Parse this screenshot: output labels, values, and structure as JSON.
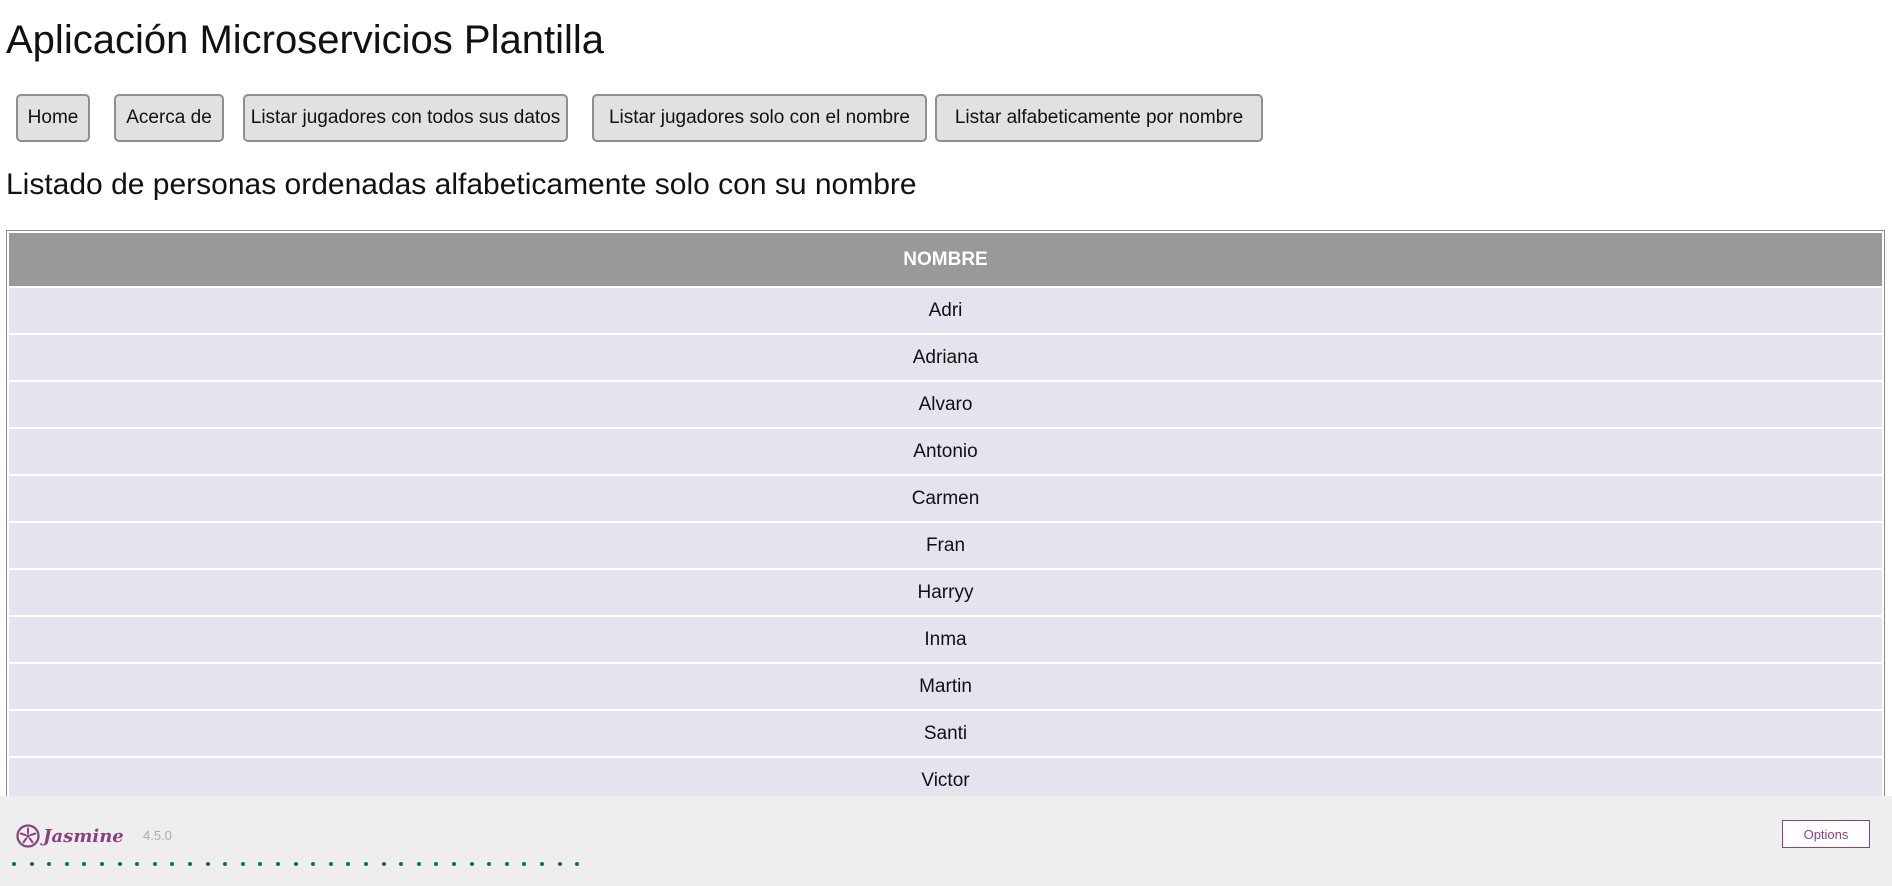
{
  "app": {
    "title": "Aplicación Microservicios Plantilla"
  },
  "nav": {
    "buttons": [
      {
        "label": "Home"
      },
      {
        "label": "Acerca de"
      },
      {
        "label": "Listar jugadores con todos sus datos"
      },
      {
        "label": "Listar jugadores solo con el nombre"
      },
      {
        "label": "Listar alfabeticamente por nombre"
      }
    ]
  },
  "section": {
    "title": "Listado de personas ordenadas alfabeticamente solo con su nombre"
  },
  "table": {
    "header": "NOMBRE",
    "rows": [
      "Adri",
      "Adriana",
      "Alvaro",
      "Antonio",
      "Carmen",
      "Fran",
      "Harryy",
      "Inma",
      "Martin",
      "Santi",
      "Victor"
    ]
  },
  "jasmine": {
    "name": "Jasmine",
    "version": "4.5.0",
    "options_label": "Options",
    "status_dots_count": 33,
    "icon": "jasmine-flower-icon"
  },
  "colors": {
    "header_bg": "#999999",
    "row_bg": "#e4e4ee",
    "jasmine_purple": "#8a4182",
    "dot_green": "#007069"
  }
}
